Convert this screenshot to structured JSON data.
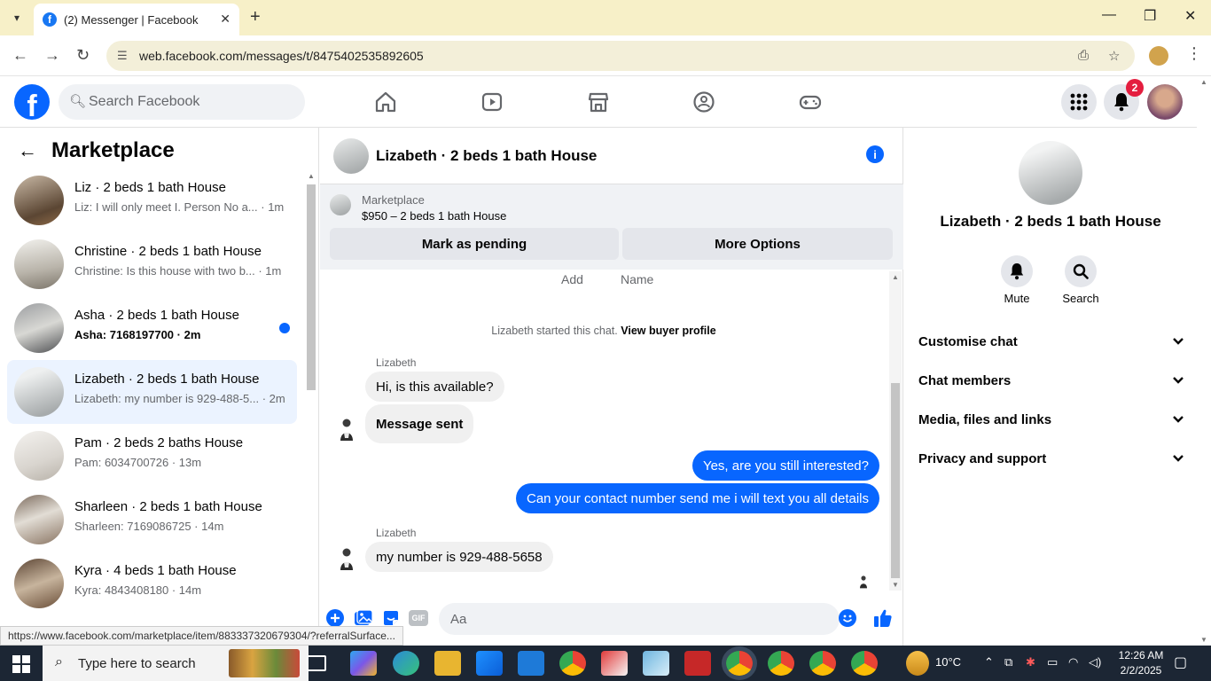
{
  "browser": {
    "tab_title": "(2) Messenger | Facebook",
    "url": "web.facebook.com/messages/t/8475402535892605",
    "status_url": "https://www.facebook.com/marketplace/item/883337320679304/?referralSurface..."
  },
  "fb": {
    "search_placeholder": "Search Facebook",
    "notification_count": "2"
  },
  "sidebar": {
    "title": "Marketplace",
    "conversations": [
      {
        "title": "Liz · 2 beds 1 bath House",
        "snippet": "Liz: I will only meet I. Person No a... · 1m"
      },
      {
        "title": "Christine · 2 beds 1 bath House",
        "snippet": "Christine: Is this house with two b... · 1m"
      },
      {
        "title": "Asha · 2 beds 1 bath House",
        "snippet": "Asha: 7168197700 · 2m"
      },
      {
        "title": "Lizabeth · 2 beds 1 bath House",
        "snippet": "Lizabeth: my number is 929-488-5... · 2m"
      },
      {
        "title": "Pam · 2 beds 2 baths House",
        "snippet": "Pam: 6034700726 · 13m"
      },
      {
        "title": "Sharleen · 2 beds 1 bath House",
        "snippet": "Sharleen: 7169086725 · 14m"
      },
      {
        "title": "Kyra · 4 beds 1 bath House",
        "snippet": "Kyra: 4843408180 · 14m"
      }
    ]
  },
  "chat": {
    "title": "Lizabeth · 2 beds 1 bath House",
    "marketplace_label": "Marketplace",
    "listing": "$950 – 2 beds 1 bath House",
    "mark_pending": "Mark as pending",
    "more_options": "More Options",
    "top_captions": [
      "Add",
      "Name"
    ],
    "system_who": "Lizabeth started this chat.",
    "system_link": "View buyer profile",
    "messages": [
      {
        "sender": "Lizabeth",
        "text": "Hi, is this available?"
      },
      {
        "text": "Message sent"
      },
      {
        "text": "Yes, are you still interested?"
      },
      {
        "text": "Can your contact number send me i will text you all details"
      },
      {
        "sender": "Lizabeth",
        "text": "my number is 929-488-5658"
      }
    ],
    "composer_placeholder": "Aa",
    "gif_label": "GIF"
  },
  "info": {
    "name": "Lizabeth · 2 beds 1 bath House",
    "actions": [
      "Mute",
      "Search"
    ],
    "sections": [
      "Customise chat",
      "Chat members",
      "Media, files and links",
      "Privacy and support"
    ]
  },
  "taskbar": {
    "search_placeholder": "Type here to search",
    "weather": "10°C",
    "time": "12:26 AM",
    "date": "2/2/2025"
  },
  "colors": {
    "fb_blue": "#0866ff",
    "tab_strip": "#f7f0c8",
    "notification_red": "#e41e3f",
    "taskbar": "#1c2634"
  }
}
